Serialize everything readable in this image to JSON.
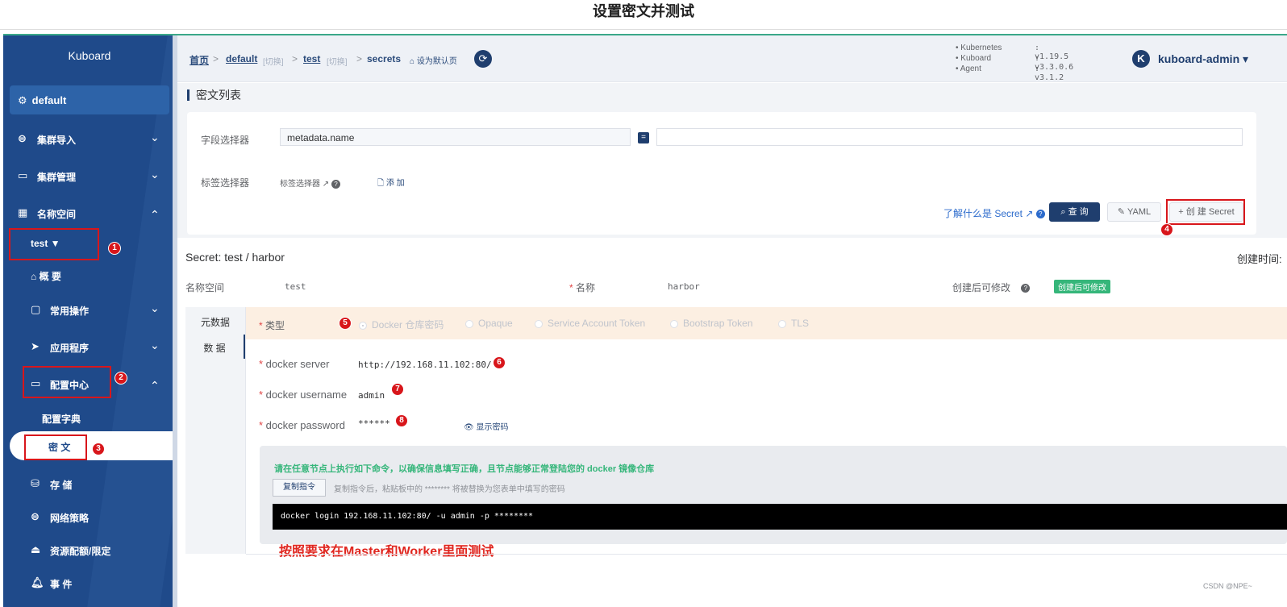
{
  "page_title": "设置密文并测试",
  "sidebar": {
    "brand": "Kuboard",
    "namespace_selector": "default",
    "items": [
      {
        "icon": "cluster-import-icon",
        "label": "集群导入",
        "chevron": "⌄"
      },
      {
        "icon": "cluster-manage-icon",
        "label": "集群管理",
        "chevron": "⌄"
      },
      {
        "icon": "namespace-icon",
        "label": "名称空间",
        "chevron": "⌃"
      }
    ],
    "namespace": "test ▼",
    "overview": "概 要",
    "common_ops": "常用操作",
    "apps": "应用程序",
    "config_center": "配置中心",
    "config_map": "配置字典",
    "secret": "密 文",
    "storage": "存 储",
    "network_policy": "网络策略",
    "quota": "资源配额/限定",
    "events": "事 件"
  },
  "header": {
    "home": "首页",
    "cluster": "default",
    "switch1": "[切换]",
    "namespace": "test",
    "switch2": "[切换]",
    "resource": "secrets",
    "set_default": "设为默认页",
    "versions": [
      {
        "name": "Kubernetes",
        "value": ": v1.19.5"
      },
      {
        "name": "Kuboard",
        "value": ": v3.3.0.6"
      },
      {
        "name": "Agent",
        "value": ": v3.1.2"
      }
    ],
    "user_initial": "K",
    "user_name": "kuboard-admin ▾"
  },
  "list": {
    "title": "密文列表",
    "field_selector_label": "字段选择器",
    "field_selector_value": "metadata.name",
    "eq": "=",
    "label_selector_label": "标签选择器",
    "label_selector_hint": "标签选择器 ↗",
    "add": "🗋 添 加",
    "learn": "了解什么是 Secret ↗",
    "query": "⌕ 查 询",
    "yaml": "✎ YAML",
    "create": "+ 创 建 Secret"
  },
  "detail": {
    "title": "Secret: test / harbor",
    "created_time": "创建时间:",
    "namespace_label": "名称空间",
    "namespace_value": "test",
    "name_label": "名称",
    "name_value": "harbor",
    "editable_label": "创建后可修改",
    "editable_badge": "创建后可修改",
    "tab_meta": "元数据",
    "tab_data": "数 据",
    "type_label": "类型",
    "types": [
      "Docker 仓库密码",
      "Opaque",
      "Service Account Token",
      "Bootstrap Token",
      "TLS"
    ],
    "server_label": "docker server",
    "server_value": "http://192.168.11.102:80/",
    "username_label": "docker username",
    "username_value": "admin",
    "password_label": "docker password",
    "password_value": "******",
    "show_password": "👁 显示密码",
    "cmd_tip": "请在任意节点上执行如下命令，以确保信息填写正确，且节点能够正常登陆您的 docker 镜像仓库",
    "copy_btn": "复制指令",
    "copy_tip": "复制指令后，粘贴板中的 ******** 将被替换为您表单中填写的密码",
    "command": "docker login 192.168.11.102:80/ -u admin -p ********",
    "annotation": "按照要求在Master和Worker里面测试"
  },
  "markers": [
    "1",
    "2",
    "3",
    "4",
    "5",
    "6",
    "7",
    "8"
  ],
  "watermark": "CSDN @NPE~"
}
